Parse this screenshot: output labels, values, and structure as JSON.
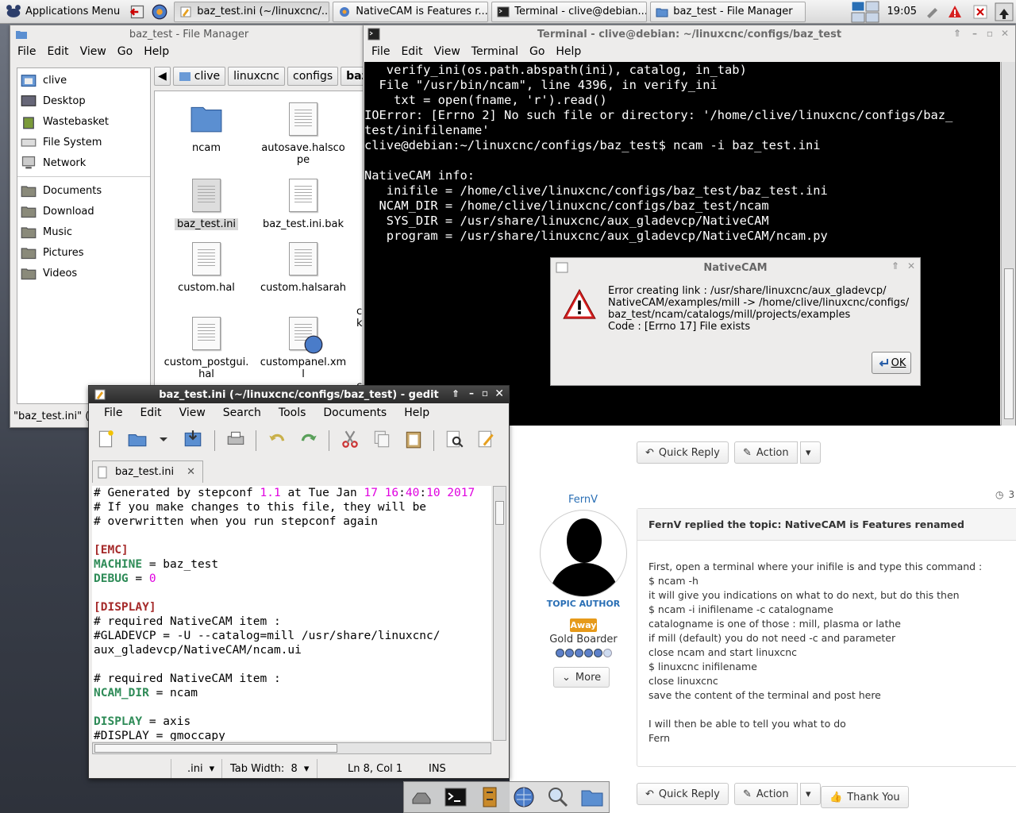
{
  "panel": {
    "app_menu": "Applications Menu",
    "tasks": [
      "baz_test.ini (~/linuxcnc/...",
      "NativeCAM is Features r...",
      "Terminal - clive@debian...",
      "baz_test - File Manager"
    ],
    "clock": "19:05"
  },
  "file_manager": {
    "title": "baz_test - File Manager",
    "menu": [
      "File",
      "Edit",
      "View",
      "Go",
      "Help"
    ],
    "places": [
      "clive",
      "Desktop",
      "Wastebasket",
      "File System",
      "Network"
    ],
    "bookmarks": [
      "Documents",
      "Download",
      "Music",
      "Pictures",
      "Videos"
    ],
    "path": [
      "clive",
      "linuxcnc",
      "configs",
      "baz_t"
    ],
    "files": [
      "ncam",
      "autosave.halscope",
      "baz_test.ini",
      "baz_test.ini.bak",
      "custom.hal",
      "custom.halsarah",
      "custom_postgui.hal",
      "custompanel.xml"
    ],
    "status": "\"baz_test.ini\" (",
    "partial": [
      "cu",
      "k",
      "c",
      "c"
    ]
  },
  "terminal": {
    "title": "Terminal - clive@debian: ~/linuxcnc/configs/baz_test",
    "menu": [
      "File",
      "Edit",
      "View",
      "Terminal",
      "Go",
      "Help"
    ],
    "lines": [
      "   verify_ini(os.path.abspath(ini), catalog, in_tab)",
      "  File \"/usr/bin/ncam\", line 4396, in verify_ini",
      "    txt = open(fname, 'r').read()",
      "IOError: [Errno 2] No such file or directory: '/home/clive/linuxcnc/configs/baz_",
      "test/inifilename'",
      "clive@debian:~/linuxcnc/configs/baz_test$ ncam -i baz_test.ini",
      "",
      "NativeCAM info:",
      "   inifile = /home/clive/linuxcnc/configs/baz_test/baz_test.ini",
      "  NCAM_DIR = /home/clive/linuxcnc/configs/baz_test/ncam",
      "   SYS_DIR = /usr/share/linuxcnc/aux_gladevcp/NativeCAM",
      "   program = /usr/share/linuxcnc/aux_gladevcp/NativeCAM/ncam.py"
    ]
  },
  "dialog": {
    "title": "NativeCAM",
    "lines": [
      "Error creating link : /usr/share/linuxcnc/aux_gladevcp/",
      "NativeCAM/examples/mill -> /home/clive/linuxcnc/configs/",
      "baz_test/ncam/catalogs/mill/projects/examples",
      "Code : [Errno 17] File exists"
    ],
    "ok": "OK"
  },
  "forum": {
    "quick_reply": "Quick Reply",
    "action": "Action",
    "thank_you": "Thank You",
    "time_partial": "3",
    "username": "FernV",
    "topic_author": "TOPIC AUTHOR",
    "status": "Away",
    "rank": "Gold Boarder",
    "more": "More",
    "post_title": "FernV replied the topic: NativeCAM is Features renamed",
    "post_lines": [
      "First, open a terminal where your inifile is and type this command :",
      "$ ncam -h",
      "it will give you indications on what to do next, but do this then",
      "$ ncam -i inifilename -c catalogname",
      "catalogname is one of those : mill, plasma or lathe",
      "if mill (default) you do not need -c and parameter",
      "close ncam and start linuxcnc",
      "$ linuxcnc inifilename",
      "close linuxcnc",
      "save the content of the terminal and post here",
      "",
      "I will then be able to tell you what to do",
      "Fern"
    ]
  },
  "gedit": {
    "title": "baz_test.ini (~/linuxcnc/configs/baz_test) - gedit",
    "menu": [
      "File",
      "Edit",
      "View",
      "Search",
      "Tools",
      "Documents",
      "Help"
    ],
    "tab": "baz_test.ini",
    "code": [
      [
        [
          "c",
          "# Generated by stepconf "
        ],
        [
          "n",
          "1.1"
        ],
        [
          "c",
          " at Tue Jan "
        ],
        [
          "n",
          "17"
        ],
        [
          "c",
          " "
        ],
        [
          "n",
          "16"
        ],
        [
          "c",
          ":"
        ],
        [
          "n",
          "40"
        ],
        [
          "c",
          ":"
        ],
        [
          "n",
          "10"
        ],
        [
          "c",
          " "
        ],
        [
          "n",
          "2017"
        ]
      ],
      [
        [
          "c",
          "# If you make changes to this file, they will be"
        ]
      ],
      [
        [
          "c",
          "# overwritten when you run stepconf again"
        ]
      ],
      [],
      [
        [
          "s",
          "[EMC]"
        ]
      ],
      [
        [
          "k",
          "MACHINE"
        ],
        [
          "c",
          " = baz_test"
        ]
      ],
      [
        [
          "k",
          "DEBUG"
        ],
        [
          "c",
          " = "
        ],
        [
          "n",
          "0"
        ]
      ],
      [],
      [
        [
          "s",
          "[DISPLAY]"
        ]
      ],
      [
        [
          "c",
          "# required NativeCAM item :"
        ]
      ],
      [
        [
          "c",
          "#GLADEVCP = -U --catalog=mill /usr/share/linuxcnc/"
        ]
      ],
      [
        [
          "c",
          "aux_gladevcp/NativeCAM/ncam.ui"
        ]
      ],
      [],
      [
        [
          "c",
          "# required NativeCAM item :"
        ]
      ],
      [
        [
          "k",
          "NCAM_DIR"
        ],
        [
          "c",
          " = ncam"
        ]
      ],
      [],
      [
        [
          "k",
          "DISPLAY"
        ],
        [
          "c",
          " = axis"
        ]
      ],
      [
        [
          "c",
          "#DISPLAY = gmoccapy"
        ]
      ]
    ],
    "lang": ".ini",
    "tab_width": "Tab Width:  8",
    "position": "Ln 8, Col 1",
    "mode": "INS"
  },
  "colors": {
    "terminal_bg": "#000000",
    "accent": "#2a6fb5",
    "syntax_section": "#a52a2a",
    "syntax_key": "#2e8b57",
    "syntax_number": "#e000e0",
    "warning": "#d62020"
  }
}
